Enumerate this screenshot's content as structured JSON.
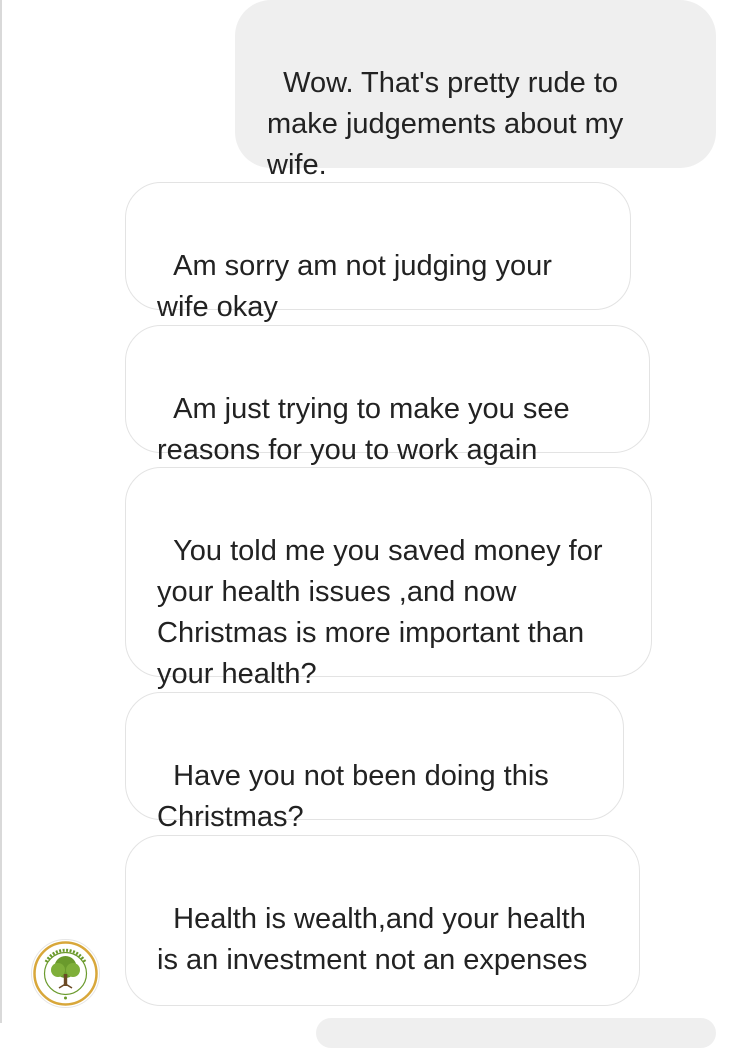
{
  "conversation": {
    "messages": [
      {
        "sender": "me",
        "text": "Wow. That's pretty rude to make judgements about my wife."
      },
      {
        "sender": "them",
        "text": "Am sorry am not judging your wife okay"
      },
      {
        "sender": "them",
        "text": "Am just trying to make you see reasons for you to work again"
      },
      {
        "sender": "them",
        "text": "You told me you saved money for your health issues ,and now Christmas is more important than your health?"
      },
      {
        "sender": "them",
        "text": "Have you not been doing this Christmas?"
      },
      {
        "sender": "them",
        "text": "Health is wealth,and your health is an investment not an expenses"
      }
    ]
  },
  "avatar": {
    "icon": "tree-logo-icon",
    "logo_text": "HERBS AND ROOTS"
  },
  "colors": {
    "sent_bubble_bg": "#efefef",
    "received_bubble_border": "#e3e3e3",
    "text": "#222222",
    "logo_green": "#6a9a2c",
    "logo_gold": "#d8a73a"
  }
}
